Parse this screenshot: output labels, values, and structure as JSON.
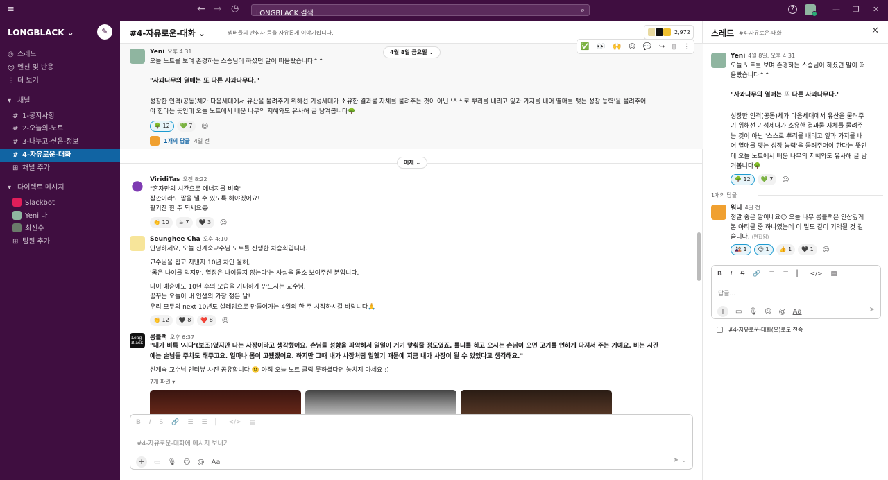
{
  "top": {
    "search": "LONGBLACK 검색"
  },
  "sidebar": {
    "workspace": "LONGBLACK",
    "threads": "스레드",
    "mentions": "멘션 및 반응",
    "more": "더 보기",
    "channels_head": "채널",
    "channels": [
      "1-공지사항",
      "2-오늘의-노트",
      "3-나누고-싶은-정보",
      "4-자유로운-대화"
    ],
    "add_channel": "채널 추가",
    "dm_head": "다이렉트 메시지",
    "dms": [
      "Slackbot",
      "Yeni  나",
      "최진수"
    ],
    "add_member": "팀원 추가"
  },
  "channel": {
    "name": "#4-자유로운-대화",
    "desc": "멤버들의 관심사 등을 자유롭게 이야기합니다.",
    "members": "2,972"
  },
  "date1": "4월 8일 금요일",
  "date2": "어제",
  "m1": {
    "name": "Yeni",
    "time": "오후 4:31",
    "l1": "오늘 노트를 보며 존경하는 스승님이 하셨던 말이 떠올랐습니다^^",
    "l2": "\"사과나무의 열매는 또 다른 사과나무다.\"",
    "l3": "성장한 인격(공동)체가 다음세대에서 유산을 물려주기 위해선 기성세대가 소유한 결과물 자체를 물려주는 것이 아닌 '스스로 뿌리를 내리고 잎과 가지를 내어 열매를 맺는 성장 능력'을 물려주어",
    "l4": "야 한다는 뜻인데 오늘 노트에서 배운 나무의 지혜와도 유사해 글 남겨봅니다🌳",
    "r1": "🌳 12",
    "r2": "💚 7",
    "replies": "1개의 답글",
    "reply_time": "4일 전"
  },
  "m2": {
    "name": "ViridiTas",
    "time": "오전 8:22",
    "l1": "\"혼자만의 시간으로 에너지를 비축\"",
    "l2": "잠깐이라도 짬을 낼 수 있도록 해야겠어요!",
    "l3": "활기찬 한 주 되세요😁",
    "r1": "👏 10",
    "r2": "☕ 7",
    "r3": "🖤 3"
  },
  "m3": {
    "name": "Seunghee Cha",
    "time": "오후 4:10",
    "l1": "안녕하세요, 오늘 신계숙교수님 노트를 진행한 차승희입니다.",
    "l2": "교수님을 뵙고 지낸지 10년 차인 올해,",
    "l3": "'몸은 나이를 먹지만, 열정은 나이들지 않는다'는 사실을 몸소 보여주신 분입니다.",
    "l4": "나이 예순에도 10년 후의 모습을 기대하게 만드시는 교수님.",
    "l5": "꿈꾸는 오늘이 내 인생의 가장 젊은 날!",
    "l6": "우리 모두의 next 10년도 설레임으로 만들어가는 4월의 한 주 시작하시길 바랍니다🙏",
    "r1": "👏 12",
    "r2": "🖤 8",
    "r3": "❤️ 8"
  },
  "m4": {
    "name": "롱블랙",
    "time": "오후 6:37",
    "l1": "\"내가 비록 '시다'(보조)였지만 나는 사장이라고 생각했어요. 손님들 성향을 파악해서 일일이 거기 맞춰줄 정도였죠. 틀니를 하고 오시는 손님이 오면 고기를 연하게 다져서 주는 거예요. 비는 시간",
    "l2": "에는 손님들 주차도 해주고요. 얼마나 몸이 고됐겠어요. 하지만 그때 내가 사장처럼 일했기 때문에 지금 내가 사장이 될 수 있었다고 생각해요.\"",
    "l3": "신계숙 교수님 인터뷰 사진 공유합니다 🙂 아직 오늘 노트 클릭 못하셨다면 놓치지 마세요 :)",
    "files": "7개 파일",
    "logo": "Long Black"
  },
  "composer": {
    "placeholder": "#4-자유로운-대화에 메시지 보내기",
    "aa": "Aa"
  },
  "thread": {
    "title": "스레드",
    "sub": "#4-자유로운-대화",
    "name": "Yeni",
    "time": "4월 8일, 오후 4:31",
    "t1": "오늘 노트를 보며 존경하는 스승님이 하셨던 말이 떠",
    "t2": "올랐습니다^^",
    "t3": "\"사과나무의 열매는 또 다른 사과나무다.\"",
    "t4": "성장한 인격(공동)체가 다음세대에서 유산을 물려주",
    "t5": "기 위해선 기성세대가 소유한 결과물 자체를 물려주",
    "t6": "는 것이 아닌 '스스로 뿌리를 내리고 잎과 가지를 내",
    "t7": "어 열매를 맺는 성장 능력'을 물려주어야 한다는 뜻인",
    "t8": "데 오늘 노트에서 배운 나무의 지혜와도 유사해 글 남",
    "t9": "겨봅니다🌳",
    "r1": "🌳 12",
    "r2": "💚 7",
    "reply_count": "1개의 답글",
    "rname": "워니",
    "rtime": "4일 전",
    "rt1": "정말 좋은 말이네요😊 오늘 나무 롱블랙은 인상깊게",
    "rt2": "본 아티클 중 하나였는데 이 말도 같이 기억될 것 같",
    "rt3": "습니다.",
    "edited": "(편집됨)",
    "rr1": "🎎 1",
    "rr2": "😌 1",
    "rr3": "👍 1",
    "rr4": "🖤 1",
    "placeholder": "답글...",
    "aa": "Aa",
    "also": "#4-자유로운-대화(으)로도 전송"
  }
}
